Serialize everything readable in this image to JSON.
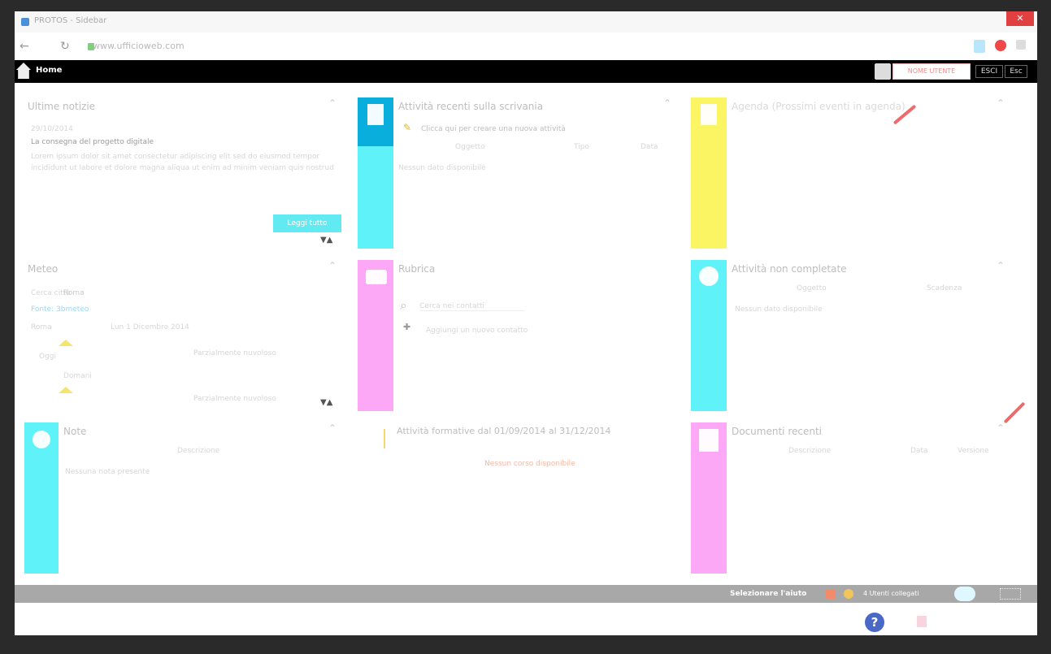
{
  "browser": {
    "tab_title": "PROTOS - Sidebar",
    "url": "www.ufficioweb.com",
    "close": "✕"
  },
  "header": {
    "home_label": "Home",
    "user_button": "NOME UTENTE",
    "esci": "ESCI",
    "esc2": "Esc"
  },
  "panels": {
    "news": {
      "title": "Ultime notizie",
      "date": "29/10/2014",
      "headline": "La consegna del progetto digitale",
      "body": "Lorem ipsum dolor sit amet consectetur adipiscing elit sed do eiusmod tempor incididunt ut labore et dolore magna aliqua ut enim ad minim veniam quis nostrud",
      "button": "Leggi tutto"
    },
    "activity": {
      "title": "Attività recenti sulla scrivania",
      "hint": "Clicca qui per creare una nuova attività",
      "col1": "Oggetto",
      "col2": "Tipo",
      "col3": "Data",
      "empty": "Nessun dato disponibile"
    },
    "agenda": {
      "title": "Agenda (Prossimi eventi in agenda)"
    },
    "meteo": {
      "title": "Meteo",
      "city": "Roma",
      "label": "Cerca città",
      "provider": "Fonte: 3bmeteo",
      "date": "Lun 1 Dicembre 2014",
      "today": "Oggi",
      "desc": "Parzialmente nuvoloso",
      "tomorrow": "Domani"
    },
    "rubrica": {
      "title": "Rubrica",
      "search": "Cerca nei contatti",
      "new": "Aggiungi un nuovo contatto"
    },
    "incomplete": {
      "title": "Attività non completate",
      "col1": "Oggetto",
      "col2": "Scadenza",
      "empty": "Nessun dato disponibile"
    },
    "notes": {
      "title": "Note",
      "col1": "Descrizione",
      "empty": "Nessuna nota presente"
    },
    "period": {
      "title": "Attività formative dal 01/09/2014 al 31/12/2014",
      "empty": "Nessun corso disponibile"
    },
    "docs": {
      "title": "Documenti recenti",
      "col1": "Descrizione",
      "col2": "Data",
      "col3": "Versione"
    }
  },
  "footer": {
    "select_label": "Selezionare l'aiuto",
    "info": "4 Utenti collegati",
    "help": "?"
  },
  "colors": {
    "cyan": "#5ff2f8",
    "pink": "#fca8f7",
    "yellow": "#fbf564",
    "blue": "#0aaedc",
    "red": "#ef6a6a"
  }
}
